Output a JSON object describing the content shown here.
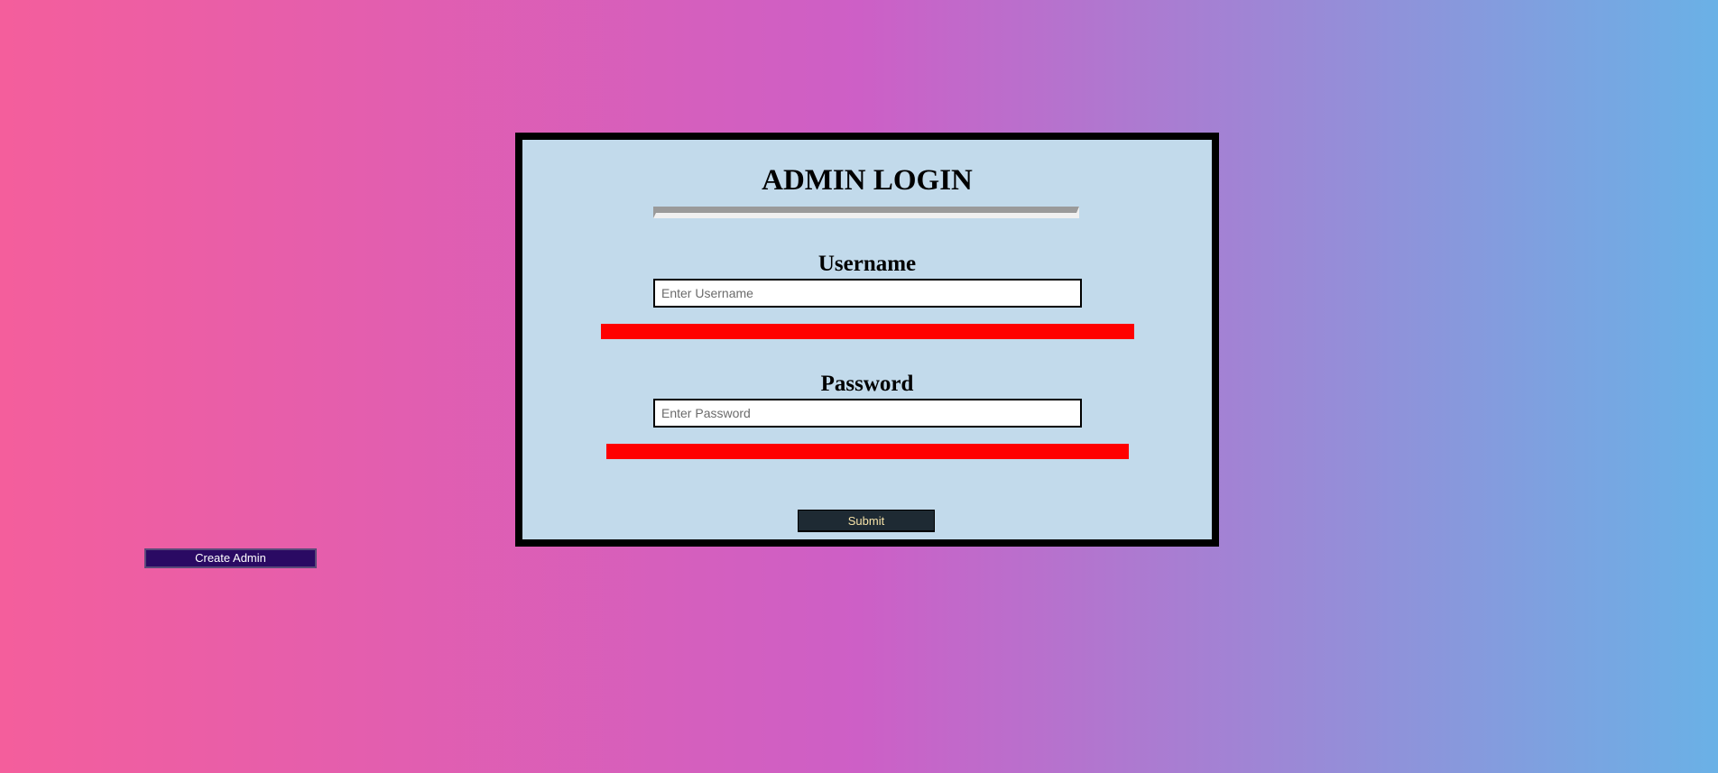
{
  "login": {
    "title": "ADMIN LOGIN",
    "username": {
      "label": "Username",
      "placeholder": "Enter Username",
      "value": ""
    },
    "password": {
      "label": "Password",
      "placeholder": "Enter Password",
      "value": ""
    },
    "submit_label": "Submit"
  },
  "actions": {
    "create_admin_label": "Create Admin"
  },
  "colors": {
    "background_gradient": [
      "#f45e9c",
      "#cd5fc6",
      "#6ab1e6"
    ],
    "panel_background": "#c2daeb",
    "panel_border": "#000000",
    "error_bar": "#ff0000",
    "submit_background": "#1e2a33",
    "submit_text": "#f6e2a8",
    "create_admin_background": "#2a0a63"
  }
}
